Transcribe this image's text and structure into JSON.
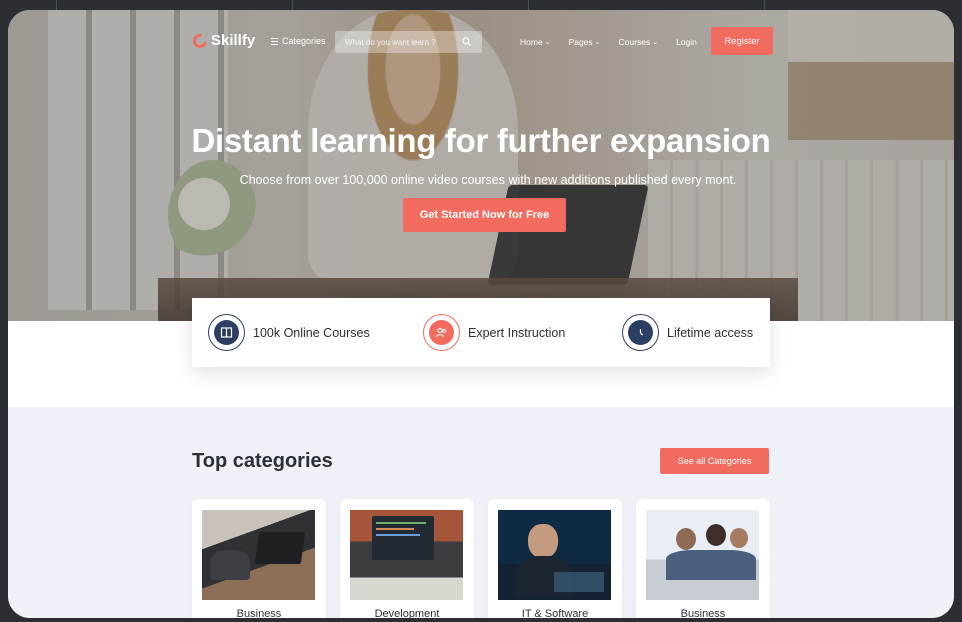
{
  "nav": {
    "logo": "Skillfy",
    "categories_label": "Categories",
    "search_placeholder": "What do you want learn ?",
    "links": [
      {
        "label": "Home",
        "dropdown": true
      },
      {
        "label": "Pages",
        "dropdown": true
      },
      {
        "label": "Courses",
        "dropdown": true
      },
      {
        "label": "Login",
        "dropdown": false
      }
    ],
    "register_label": "Register"
  },
  "hero": {
    "title": "Distant learning for further expansion",
    "subtitle": "Choose from over 100,000 online video courses with new additions published every mont.",
    "cta_label": "Get Started Now for Free"
  },
  "features": [
    {
      "label": "100k Online Courses",
      "icon": "book-icon",
      "color": "#2d3e63"
    },
    {
      "label": "Expert Instruction",
      "icon": "users-icon",
      "color": "#f26b5f"
    },
    {
      "label": "Lifetime access",
      "icon": "clock-icon",
      "color": "#2d3e63"
    }
  ],
  "categories": {
    "title": "Top categories",
    "see_all_label": "See all Categories",
    "items": [
      {
        "label": "Business"
      },
      {
        "label": "Development"
      },
      {
        "label": "IT & Software"
      },
      {
        "label": "Business"
      }
    ]
  },
  "colors": {
    "accent": "#f26b5f",
    "navy": "#2d3e63",
    "section_bg": "#f0f1f8"
  }
}
